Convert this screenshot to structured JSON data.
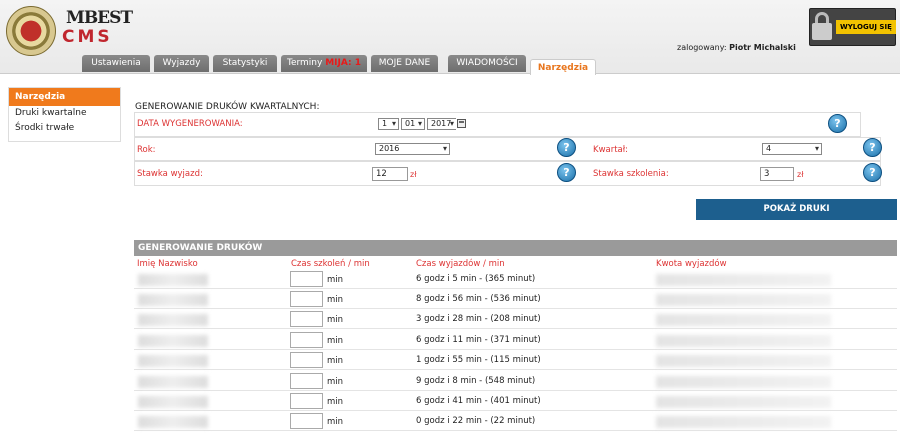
{
  "header": {
    "logo_top": "MBEST",
    "logo_bottom": "CMS",
    "logged_label": "zalogowany:",
    "user_name": "Piotr Michalski",
    "logout_label": "WYLOGUJ SIĘ"
  },
  "tabs": [
    {
      "label": "Ustawienia"
    },
    {
      "label": "Wyjazdy"
    },
    {
      "label": "Statystyki"
    },
    {
      "label": "Terminy",
      "badge": "MIJA: 1"
    },
    {
      "label": "MOJE DANE"
    },
    {
      "label": "WIADOMOŚCI"
    },
    {
      "label": "Narzędzia",
      "active": true
    }
  ],
  "sidebar": {
    "title": "Narzędzia",
    "items": [
      "Druki kwartalne",
      "Środki trwałe"
    ]
  },
  "form": {
    "title": "GENEROWANIE DRUKÓW KWARTALNYCH:",
    "date_label": "DATA WYGENEROWANIA:",
    "date_day": "1",
    "date_month": "01",
    "date_year": "2017",
    "year_label": "Rok:",
    "year_value": "2016",
    "quarter_label": "Kwartał:",
    "quarter_value": "4",
    "trip_rate_label": "Stawka wyjazd:",
    "trip_rate_value": "12",
    "trip_rate_unit": "zł",
    "training_rate_label": "Stawka szkolenia:",
    "training_rate_value": "3",
    "training_rate_unit": "zł",
    "show_button": "POKAŻ DRUKI"
  },
  "table": {
    "title": "GENEROWANIE DRUKÓW",
    "columns": [
      "Imię Nazwisko",
      "Czas szkoleń / min",
      "Czas wyjazdów / min",
      "Kwota wyjazdów"
    ],
    "unit": "min",
    "rows": [
      "6 godz i 5 min - (365 minut)",
      "8 godz i 56 min - (536 minut)",
      "3 godz i 28 min - (208 minut)",
      "6 godz i 11 min - (371 minut)",
      "1 godz i 55 min - (115 minut)",
      "9 godz i 8 min - (548 minut)",
      "6 godz i 41 min - (401 minut)",
      "0 godz i 22 min - (22 minut)"
    ]
  },
  "colors": {
    "accent_orange": "#f07a1c",
    "label_red": "#dd3333",
    "button_blue": "#1d5f8e",
    "tab_gray": "#7a7a7a"
  }
}
